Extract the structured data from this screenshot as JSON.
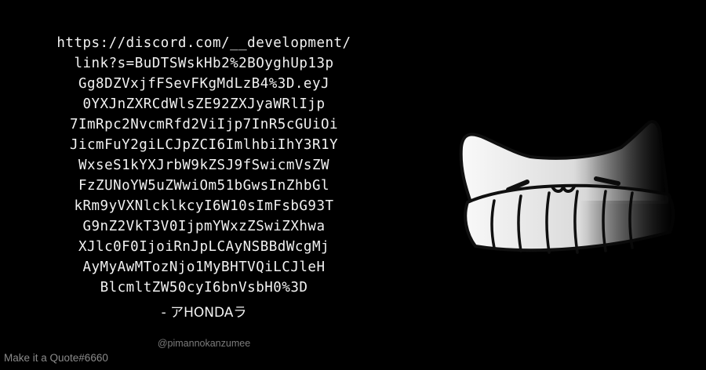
{
  "quote": {
    "lines": [
      "https://discord.com/__development/",
      "link?s=BuDTSWskHb2%2BOyghUp13p",
      "Gg8DZVxjfFSevFKgMdLzB4%3D.eyJ",
      "0YXJnZXRCdWlsZE92ZXJyaWRlIjp",
      "7ImRpc2NvcmRfd2ViIjp7InR5cGUiOi",
      "JicmFuY2giLCJpZCI6ImlhbiIhY3R1Y",
      "WxseS1kYXJrbW9kZSJ9fSwicmVsZW",
      "FzZUNoYW5uZWwiOm51bGwsInZhbGl",
      "kRm9yVXNlcklkcyI6W10sImFsbG93T",
      "G9nZ2VkT3V0IjpmYWxzZSwiZXhwa",
      "XJlc0F0IjoiRnJpLCAyNSBBdWcgMj",
      "AyMyAwMTozNjo1MyBHTVQiLCJleH",
      "BlcmltZW50cyI6bnVsbH0%3D"
    ],
    "author": "- アHONDAラ",
    "handle": "@pimannokanzumee"
  },
  "watermark": "Make it a Quote#6660",
  "avatar": {
    "icon": "cat-beanie-icon",
    "colors": {
      "fill_light": "#ffffff",
      "fill_dark": "#000000",
      "outline": "#111111"
    }
  }
}
